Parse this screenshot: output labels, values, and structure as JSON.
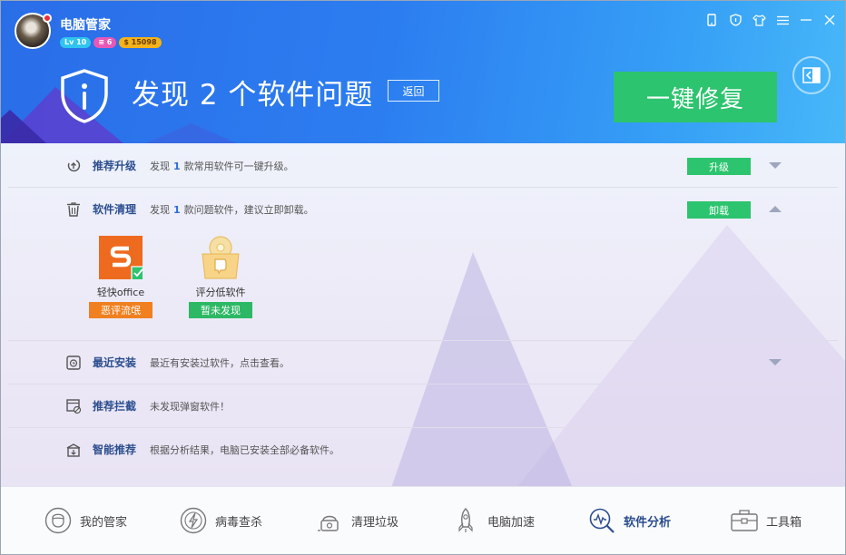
{
  "app": {
    "title": "电脑管家"
  },
  "badges": {
    "level": "Lv 10",
    "messages": "6",
    "coins": "15098"
  },
  "headline": "发现 2 个软件问题",
  "back_label": "返回",
  "fix_label": "一键修复",
  "rows": [
    {
      "title": "推荐升级",
      "desc_prefix": "发现",
      "count": "1",
      "desc_suffix": "款常用软件可一键升级。",
      "action": "升级",
      "toggle": "down",
      "icon": "upgrade-icon"
    },
    {
      "title": "软件清理",
      "desc_prefix": "发现",
      "count": "1",
      "desc_suffix": "款问题软件，建议立即卸载。",
      "action": "卸载",
      "toggle": "up",
      "icon": "trash-icon"
    },
    {
      "title": "最近安装",
      "desc": "最近有安装过软件，点击查看。",
      "toggle": "down",
      "icon": "recent-install-icon"
    },
    {
      "title": "推荐拦截",
      "desc": "未发现弹窗软件！",
      "icon": "popup-block-icon"
    },
    {
      "title": "智能推荐",
      "desc": "根据分析结果，电脑已安装全部必备软件。",
      "icon": "smart-recommend-icon"
    }
  ],
  "apps": [
    {
      "name": "轻快office",
      "tag": "恶评流氓",
      "tag_color": "#f08020",
      "icon": "office-app-icon"
    },
    {
      "name": "评分低软件",
      "tag": "暂未发现",
      "tag_color": "#2cb864",
      "icon": "low-rating-icon"
    }
  ],
  "nav": [
    {
      "label": "我的管家",
      "icon": "butler-icon"
    },
    {
      "label": "病毒查杀",
      "icon": "virus-scan-icon"
    },
    {
      "label": "清理垃圾",
      "icon": "cleanup-icon"
    },
    {
      "label": "电脑加速",
      "icon": "rocket-icon"
    },
    {
      "label": "软件分析",
      "icon": "software-analysis-icon",
      "active": true
    },
    {
      "label": "工具箱",
      "icon": "toolbox-icon"
    }
  ],
  "colors": {
    "accent_green": "#2cc46e",
    "header_blue": "#2a6de8",
    "link_blue": "#2c4e8f"
  }
}
